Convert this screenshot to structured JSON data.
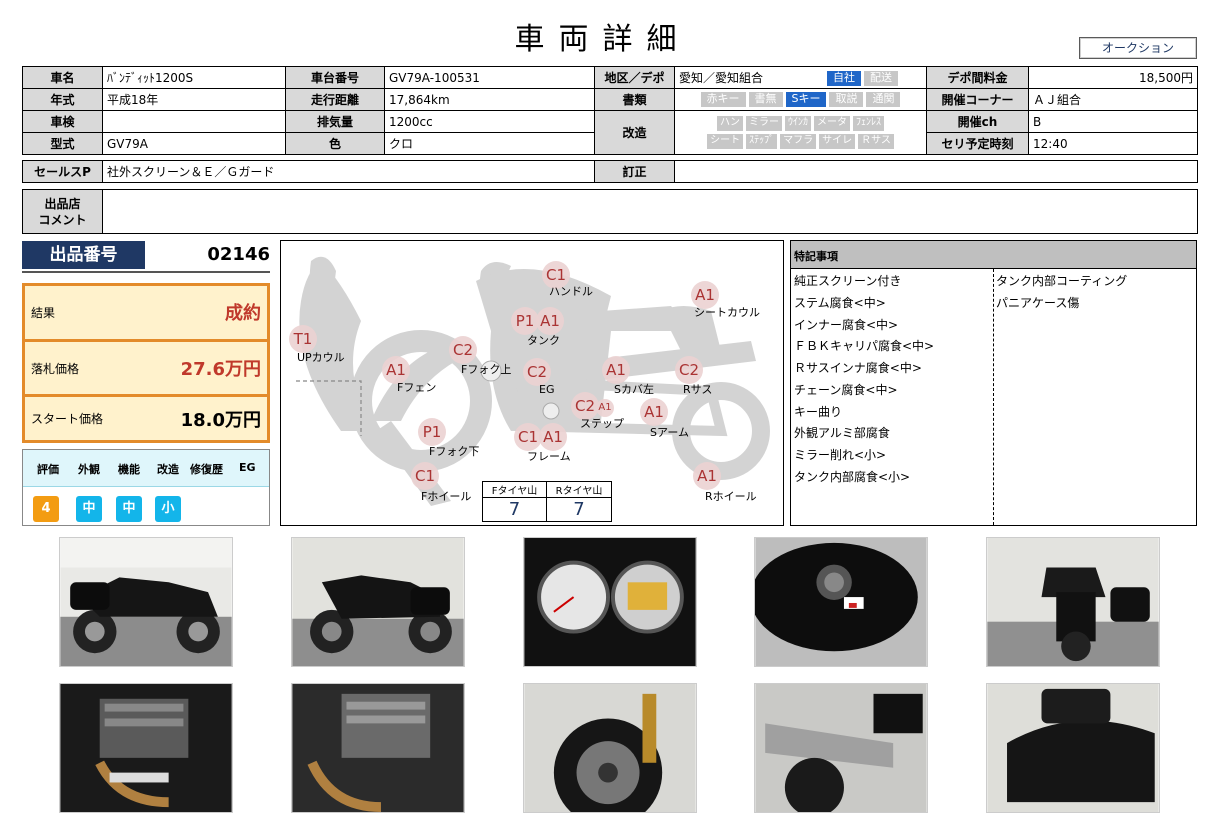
{
  "header": {
    "title": "車両詳細",
    "auction_button": "オークション"
  },
  "info": {
    "name_label": "車名",
    "name": "ﾊﾞﾝﾃﾞｨｯﾄ1200S",
    "frame_label": "車台番号",
    "frame": "GV79A-100531",
    "region_label": "地区／デポ",
    "region": "愛知／愛知組合",
    "region_pills": [
      "自社",
      "配送"
    ],
    "depot_fee_label": "デポ間料金",
    "depot_fee": "18,500円",
    "year_label": "年式",
    "year": "平成18年",
    "mileage_label": "走行距離",
    "mileage": "17,864km",
    "docs_label": "書類",
    "docs_pills": [
      "赤キー",
      "書無",
      "Sキー",
      "取説",
      "通関"
    ],
    "corner_label": "開催コーナー",
    "corner": "ＡＪ組合",
    "inspection_label": "車検",
    "inspection": "",
    "displacement_label": "排気量",
    "displacement": "1200cc",
    "mods_label": "改造",
    "mods_row1": [
      "ハン",
      "ミラー",
      "ｳｲﾝｶ",
      "メータ",
      "ﾌｪﾝﾚｽ"
    ],
    "mods_row2": [
      "シート",
      "ｽﾃｯﾌﾟ",
      "マフラ",
      "サイレ",
      "Ｒサス"
    ],
    "channel_label": "開催ch",
    "channel": "B",
    "model_label": "型式",
    "model": "GV79A",
    "color_label": "色",
    "color": "クロ",
    "time_label": "セリ予定時刻",
    "time": "12:40",
    "sales_label": "セールスP",
    "sales": "社外スクリーン＆Ｅ／Ｇガード",
    "correction_label": "訂正",
    "correction": "",
    "comment_label_1": "出品店",
    "comment_label_2": "コメント",
    "comment": ""
  },
  "lot": {
    "label": "出品番号",
    "number": "02146"
  },
  "result": {
    "result_label": "結果",
    "result_value": "成約",
    "bid_label": "落札価格",
    "bid_value": "27.6万円",
    "start_label": "スタート価格",
    "start_value": "18.0万円"
  },
  "evaluation": {
    "headers": [
      "評価",
      "外観",
      "機能",
      "改造",
      "修復歴",
      "EG"
    ],
    "values": [
      "4",
      "中",
      "中",
      "小"
    ]
  },
  "diagram": {
    "marks": {
      "handle": "C1",
      "handle_label": "ハンドル",
      "seat_cowl": "A1",
      "seat_cowl_label": "シートカウル",
      "tank_1": "P1",
      "tank_2": "A1",
      "tank_label": "タンク",
      "up_cowl": "T1",
      "up_cowl_label": "UPカウル",
      "f_fork_upper": "C2",
      "f_fork_upper_label": "Fフォク上",
      "f_fender": "A1",
      "f_fender_label": "Fフェン",
      "eg": "C2",
      "eg_label": "EG",
      "s_cover": "A1",
      "s_cover_label": "Sカバ左",
      "r_sus": "C2",
      "r_sus_label": "Rサス",
      "step_1": "C2",
      "step_2": "A1",
      "step_label": "ステップ",
      "s_arm": "A1",
      "s_arm_label": "Sアーム",
      "f_fork_lower": "P1",
      "f_fork_lower_label": "Fフォク下",
      "frame_1": "C1",
      "frame_2": "A1",
      "frame_label": "フレーム",
      "f_wheel": "C1",
      "f_wheel_label": "Fホイール",
      "r_wheel": "A1",
      "r_wheel_label": "Rホイール"
    },
    "tire_f_label": "Fタイヤ山",
    "tire_f": "7",
    "tire_r_label": "Rタイヤ山",
    "tire_r": "7"
  },
  "notes": {
    "title": "特記事項",
    "left": [
      "純正スクリーン付き",
      "ステム腐食<中>",
      "インナー腐食<中>",
      "ＦＢＫキャリパ腐食<中>",
      "Ｒサスインナ腐食<中>",
      "チェーン腐食<中>",
      "キー曲り",
      "外観アルミ部腐食",
      "ミラー削れ<小>",
      "タンク内部腐食<小>"
    ],
    "right": [
      "タンク内部コーティング",
      "パニアケース傷"
    ]
  },
  "colors": {
    "navy": "#1f3864",
    "orange": "#e38b2a",
    "cyan": "#13b5ea",
    "red_text": "#c0392b",
    "pill_blue": "#1f66c8"
  }
}
